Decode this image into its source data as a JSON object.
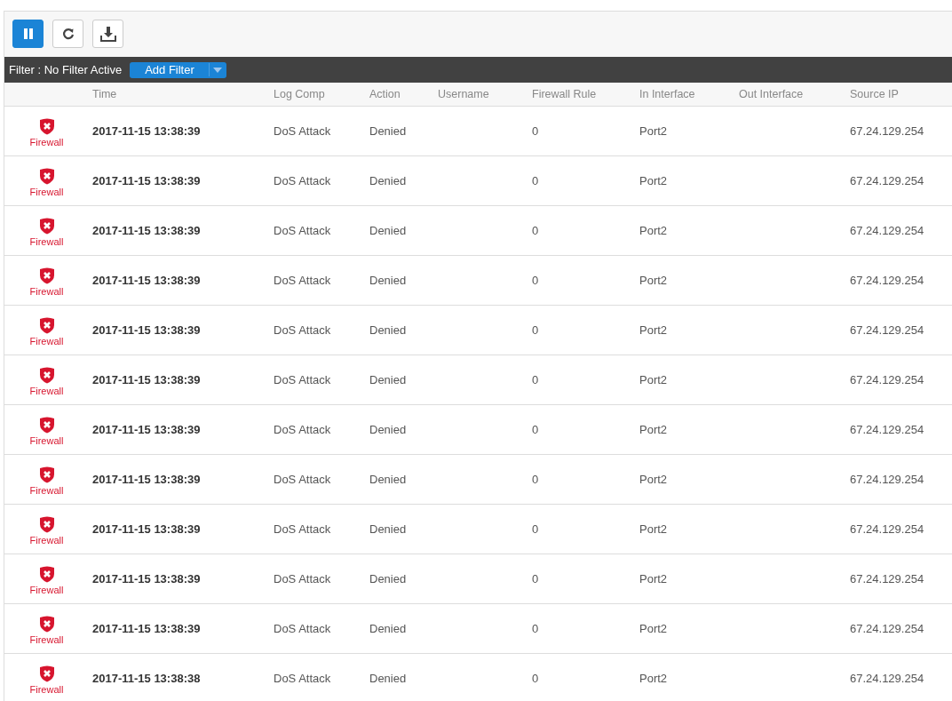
{
  "toolbar": {
    "pause_active": true
  },
  "filter_bar": {
    "label": "Filter : No Filter Active",
    "add_button": "Add Filter"
  },
  "table": {
    "columns": [
      "Time",
      "Log Comp",
      "Action",
      "Username",
      "Firewall Rule",
      "In Interface",
      "Out Interface",
      "Source IP"
    ],
    "rows": [
      {
        "module": "Firewall",
        "time": "2017-11-15 13:38:39",
        "log_comp": "DoS Attack",
        "action": "Denied",
        "username": "",
        "firewall_rule": "0",
        "in_interface": "Port2",
        "out_interface": "",
        "source_ip": "67.24.129.254"
      },
      {
        "module": "Firewall",
        "time": "2017-11-15 13:38:39",
        "log_comp": "DoS Attack",
        "action": "Denied",
        "username": "",
        "firewall_rule": "0",
        "in_interface": "Port2",
        "out_interface": "",
        "source_ip": "67.24.129.254"
      },
      {
        "module": "Firewall",
        "time": "2017-11-15 13:38:39",
        "log_comp": "DoS Attack",
        "action": "Denied",
        "username": "",
        "firewall_rule": "0",
        "in_interface": "Port2",
        "out_interface": "",
        "source_ip": "67.24.129.254"
      },
      {
        "module": "Firewall",
        "time": "2017-11-15 13:38:39",
        "log_comp": "DoS Attack",
        "action": "Denied",
        "username": "",
        "firewall_rule": "0",
        "in_interface": "Port2",
        "out_interface": "",
        "source_ip": "67.24.129.254"
      },
      {
        "module": "Firewall",
        "time": "2017-11-15 13:38:39",
        "log_comp": "DoS Attack",
        "action": "Denied",
        "username": "",
        "firewall_rule": "0",
        "in_interface": "Port2",
        "out_interface": "",
        "source_ip": "67.24.129.254"
      },
      {
        "module": "Firewall",
        "time": "2017-11-15 13:38:39",
        "log_comp": "DoS Attack",
        "action": "Denied",
        "username": "",
        "firewall_rule": "0",
        "in_interface": "Port2",
        "out_interface": "",
        "source_ip": "67.24.129.254"
      },
      {
        "module": "Firewall",
        "time": "2017-11-15 13:38:39",
        "log_comp": "DoS Attack",
        "action": "Denied",
        "username": "",
        "firewall_rule": "0",
        "in_interface": "Port2",
        "out_interface": "",
        "source_ip": "67.24.129.254"
      },
      {
        "module": "Firewall",
        "time": "2017-11-15 13:38:39",
        "log_comp": "DoS Attack",
        "action": "Denied",
        "username": "",
        "firewall_rule": "0",
        "in_interface": "Port2",
        "out_interface": "",
        "source_ip": "67.24.129.254"
      },
      {
        "module": "Firewall",
        "time": "2017-11-15 13:38:39",
        "log_comp": "DoS Attack",
        "action": "Denied",
        "username": "",
        "firewall_rule": "0",
        "in_interface": "Port2",
        "out_interface": "",
        "source_ip": "67.24.129.254"
      },
      {
        "module": "Firewall",
        "time": "2017-11-15 13:38:39",
        "log_comp": "DoS Attack",
        "action": "Denied",
        "username": "",
        "firewall_rule": "0",
        "in_interface": "Port2",
        "out_interface": "",
        "source_ip": "67.24.129.254"
      },
      {
        "module": "Firewall",
        "time": "2017-11-15 13:38:39",
        "log_comp": "DoS Attack",
        "action": "Denied",
        "username": "",
        "firewall_rule": "0",
        "in_interface": "Port2",
        "out_interface": "",
        "source_ip": "67.24.129.254"
      },
      {
        "module": "Firewall",
        "time": "2017-11-15 13:38:38",
        "log_comp": "DoS Attack",
        "action": "Denied",
        "username": "",
        "firewall_rule": "0",
        "in_interface": "Port2",
        "out_interface": "",
        "source_ip": "67.24.129.254"
      }
    ]
  }
}
